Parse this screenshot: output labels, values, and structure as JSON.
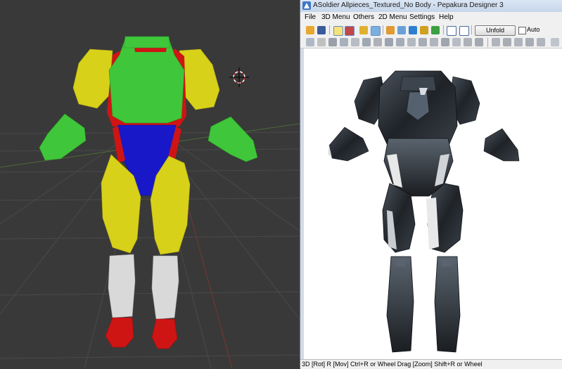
{
  "window": {
    "title": "ASoldier Allpieces_Textured_No Body - Pepakura Designer 3"
  },
  "menu": {
    "items": [
      "File",
      "3D Menu",
      "Others",
      "2D Menu",
      "Settings",
      "Help"
    ]
  },
  "toolbar": {
    "unfold_label": "Unfold",
    "auto_label": "Auto",
    "auto_checked": false
  },
  "status": {
    "text": "3D [Rot] R [Mov] Ctrl+R or Wheel Drag [Zoom] Shift+R or Wheel"
  },
  "colors": {
    "viewport_bg": "#393939",
    "armor_green": "#3fc63a",
    "armor_yellow": "#d8d11a",
    "armor_red": "#cf1414",
    "armor_blue": "#1818c8",
    "armor_white": "#d9d9d9",
    "texture_dark": "#2b3036"
  }
}
